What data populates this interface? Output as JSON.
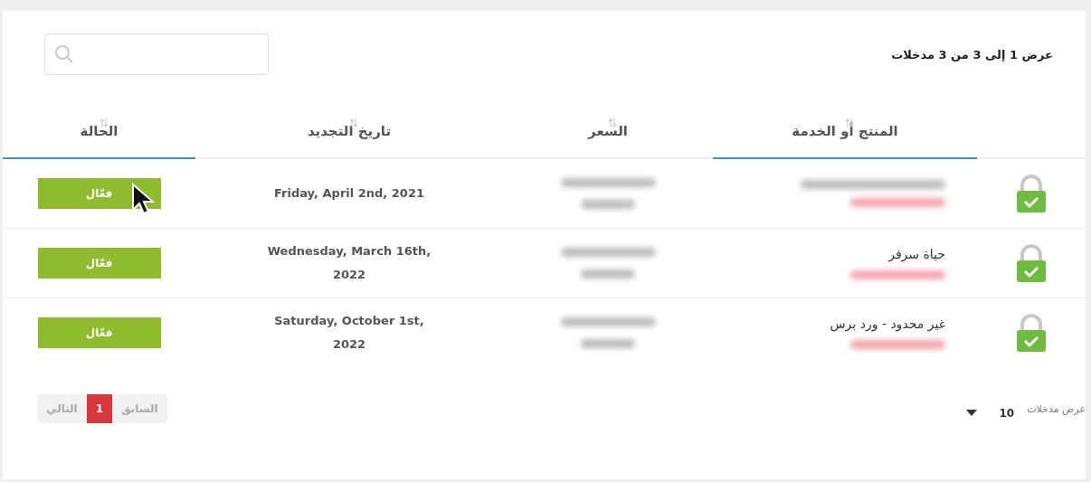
{
  "info": "عرض 1 إلى 3 من 3 مدخلات",
  "columns": [
    {
      "kind": "icon"
    },
    {
      "kind": "text",
      "label": "المنتج أو الخدمة",
      "sorted": true
    },
    {
      "kind": "text",
      "label": "السعر",
      "sorted": false
    },
    {
      "kind": "text",
      "label": "تاريخ التجديد",
      "sorted": false
    },
    {
      "kind": "text",
      "label": "الحالة",
      "sorted": true
    }
  ],
  "rows": [
    {
      "renewal": "Friday, April 2nd, 2021",
      "status": "فعّال"
    },
    {
      "product": "حياة سرفر",
      "renewal": "Wednesday, March 16th, 2022",
      "status": "فعّال"
    },
    {
      "product": "غير محدود - ورد برس",
      "renewal": "Saturday, October 1st, 2022",
      "status": "فعّال"
    }
  ],
  "page_size": {
    "label": "عرض مدخلات",
    "value": "10"
  },
  "pagination": [
    {
      "label": "السابق",
      "selected": false,
      "disabled": true
    },
    {
      "label": "1",
      "selected": true,
      "disabled": false
    },
    {
      "label": "التالي",
      "selected": false,
      "disabled": true
    }
  ]
}
